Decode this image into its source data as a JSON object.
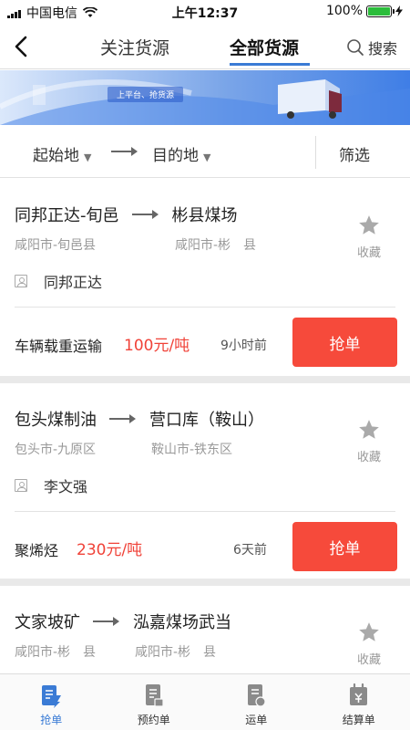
{
  "status_bar": {
    "carrier": "中国电信",
    "time": "上午12:37",
    "battery": "100%",
    "battery_level": 1.0
  },
  "nav": {
    "tabs": [
      {
        "label": "关注货源",
        "active": false
      },
      {
        "label": "全部货源",
        "active": true
      }
    ],
    "search_label": "搜索",
    "accent_color": "#3a7bd5"
  },
  "banner": {
    "slogan": "上平台、抢货源"
  },
  "filters": {
    "origin": "起始地",
    "destination": "目的地",
    "screen": "筛选"
  },
  "listings": [
    {
      "from": "同邦正达-旬邑",
      "to": "彬县煤场",
      "from_area": "咸阳市-旬邑县",
      "to_area": "咸阳市-彬　县",
      "favorite_label": "收藏",
      "contact": "同邦正达",
      "cargo": "车辆载重运输",
      "price": "100元/吨",
      "posted": "9小时前",
      "action": "抢单"
    },
    {
      "from": "包头煤制油",
      "to": "营口库（鞍山）",
      "from_area": "包头市-九原区",
      "to_area": "鞍山市-铁东区",
      "favorite_label": "收藏",
      "contact": "李文强",
      "cargo": "聚烯烃",
      "price": "230元/吨",
      "posted": "6天前",
      "action": "抢单"
    },
    {
      "from": "文家坡矿",
      "to": "泓嘉煤场武当",
      "from_area": "咸阳市-彬　县",
      "to_area": "咸阳市-彬　县",
      "favorite_label": "收藏"
    }
  ],
  "tabbar": [
    {
      "label": "抢单",
      "icon": "grab-order-icon",
      "active": true
    },
    {
      "label": "预约单",
      "icon": "reservation-icon",
      "active": false
    },
    {
      "label": "运单",
      "icon": "waybill-icon",
      "active": false
    },
    {
      "label": "结算单",
      "icon": "settlement-icon",
      "active": false
    }
  ]
}
